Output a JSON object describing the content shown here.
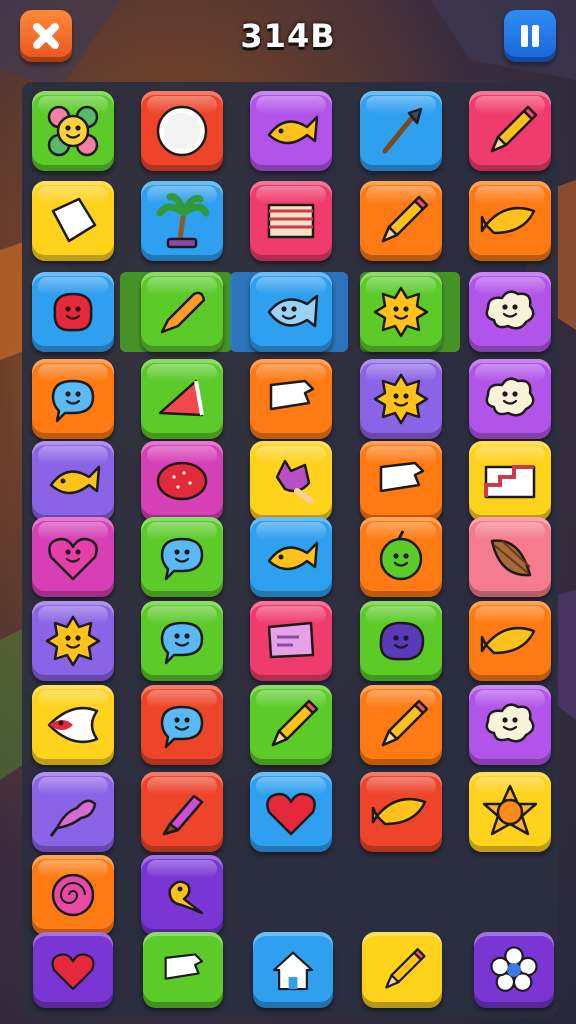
{
  "header": {
    "score": "314B",
    "close_icon": "close-x-icon",
    "pause_icon": "pause-icon"
  },
  "tile_colors": {
    "green": "#5ccb2a",
    "red": "#ee4429",
    "purple": "#b254ea",
    "blue": "#2f9ff0",
    "pink": "#f03c6d",
    "yellow": "#ffd21c",
    "orange": "#ff7a13",
    "lilac": "#8b63e6",
    "magenta": "#d63fb6",
    "peach": "#f57c8e",
    "violet": "#7a36d4"
  },
  "board": {
    "rows": [
      [
        {
          "icon": "smiling-flower-icon",
          "color": "green"
        },
        {
          "icon": "clock-face-icon",
          "color": "red"
        },
        {
          "icon": "fish-icon",
          "color": "purple"
        },
        {
          "icon": "brush-icon",
          "color": "blue"
        },
        {
          "icon": "pencil-icon",
          "color": "pink"
        }
      ],
      [
        {
          "icon": "paper-sheet-icon",
          "color": "yellow"
        },
        {
          "icon": "palm-tree-icon",
          "color": "blue"
        },
        {
          "icon": "flag-icon",
          "color": "pink"
        },
        {
          "icon": "pencil-icon",
          "color": "orange"
        },
        {
          "icon": "leaf-fish-icon",
          "color": "orange"
        }
      ],
      [
        {
          "icon": "red-blob-face-icon",
          "color": "blue"
        },
        {
          "icon": "crayon-icon",
          "color": "green"
        },
        {
          "icon": "fish-face-icon",
          "color": "blue"
        },
        {
          "icon": "sun-face-icon",
          "color": "green"
        },
        {
          "icon": "cloud-face-icon",
          "color": "purple"
        }
      ],
      [
        {
          "icon": "speech-bubble-face-icon",
          "color": "orange"
        },
        {
          "icon": "watermelon-slice-icon",
          "color": "green"
        },
        {
          "icon": "paper-note-icon",
          "color": "orange"
        },
        {
          "icon": "sun-face-icon",
          "color": "lilac"
        },
        {
          "icon": "cloud-face-icon",
          "color": "purple"
        }
      ],
      [
        {
          "icon": "fish-icon",
          "color": "lilac"
        },
        {
          "icon": "strawberry-icon",
          "color": "magenta"
        },
        {
          "icon": "popsicle-cat-icon",
          "color": "yellow"
        },
        {
          "icon": "paper-note-icon",
          "color": "orange"
        },
        {
          "icon": "staircase-chart-icon",
          "color": "yellow"
        }
      ],
      [
        {
          "icon": "heart-face-icon",
          "color": "magenta"
        },
        {
          "icon": "speech-bubble-face-icon",
          "color": "green"
        },
        {
          "icon": "fish-icon",
          "color": "blue"
        },
        {
          "icon": "green-blob-face-icon",
          "color": "orange"
        },
        {
          "icon": "cocoa-pod-icon",
          "color": "peach"
        }
      ],
      [
        {
          "icon": "sun-face-icon",
          "color": "lilac"
        },
        {
          "icon": "speech-bubble-face-icon",
          "color": "green"
        },
        {
          "icon": "flag-note-icon",
          "color": "pink"
        },
        {
          "icon": "purple-blob-face-icon",
          "color": "green"
        },
        {
          "icon": "leaf-fish-icon",
          "color": "orange"
        }
      ],
      [
        {
          "icon": "fish-head-icon",
          "color": "yellow"
        },
        {
          "icon": "speech-bubble-face-icon",
          "color": "red"
        },
        {
          "icon": "pencil-icon",
          "color": "green"
        },
        {
          "icon": "pencil-icon",
          "color": "orange"
        },
        {
          "icon": "cloud-face-icon",
          "color": "purple"
        }
      ],
      [
        {
          "icon": "seahorse-icon",
          "color": "lilac"
        },
        {
          "icon": "marker-icon",
          "color": "red"
        },
        {
          "icon": "heart-icon",
          "color": "blue"
        },
        {
          "icon": "leaf-fish-icon",
          "color": "red"
        },
        {
          "icon": "orange-star-icon",
          "color": "yellow"
        }
      ],
      [
        {
          "icon": "rose-icon",
          "color": "orange"
        },
        {
          "icon": "bird-icon",
          "color": "violet"
        }
      ]
    ]
  },
  "bottom_bar": [
    {
      "name": "heart-button",
      "icon": "heart-icon",
      "color": "violet"
    },
    {
      "name": "note-button",
      "icon": "paper-note-icon",
      "color": "green"
    },
    {
      "name": "home-button",
      "icon": "home-icon",
      "color": "blue"
    },
    {
      "name": "pencil-button",
      "icon": "pencil-icon",
      "color": "yellow"
    },
    {
      "name": "flower-button",
      "icon": "flower-icon",
      "color": "violet"
    }
  ]
}
